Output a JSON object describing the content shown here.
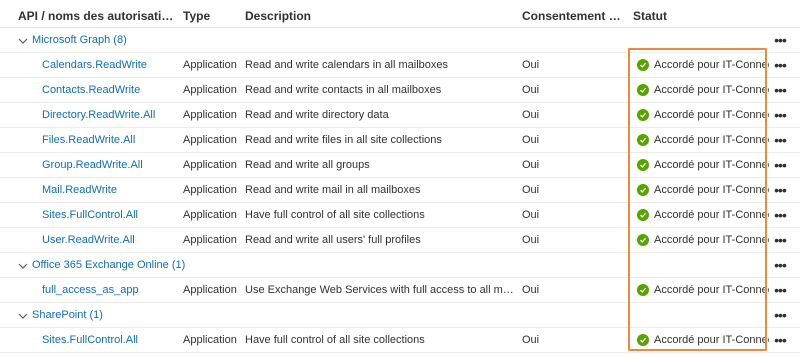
{
  "columns": {
    "name": "API / noms des autorisations",
    "type": "Type",
    "description": "Description",
    "consent": "Consentement de l'...",
    "status": "Statut"
  },
  "more_label": "•••",
  "groups": [
    {
      "label": "Microsoft Graph (8)",
      "permissions": [
        {
          "name": "Calendars.ReadWrite",
          "type": "Application",
          "description": "Read and write calendars in all mailboxes",
          "consent": "Oui",
          "status": "Accordé pour IT-Connect"
        },
        {
          "name": "Contacts.ReadWrite",
          "type": "Application",
          "description": "Read and write contacts in all mailboxes",
          "consent": "Oui",
          "status": "Accordé pour IT-Connect"
        },
        {
          "name": "Directory.ReadWrite.All",
          "type": "Application",
          "description": "Read and write directory data",
          "consent": "Oui",
          "status": "Accordé pour IT-Connect"
        },
        {
          "name": "Files.ReadWrite.All",
          "type": "Application",
          "description": "Read and write files in all site collections",
          "consent": "Oui",
          "status": "Accordé pour IT-Connect"
        },
        {
          "name": "Group.ReadWrite.All",
          "type": "Application",
          "description": "Read and write all groups",
          "consent": "Oui",
          "status": "Accordé pour IT-Connect"
        },
        {
          "name": "Mail.ReadWrite",
          "type": "Application",
          "description": "Read and write mail in all mailboxes",
          "consent": "Oui",
          "status": "Accordé pour IT-Connect"
        },
        {
          "name": "Sites.FullControl.All",
          "type": "Application",
          "description": "Have full control of all site collections",
          "consent": "Oui",
          "status": "Accordé pour IT-Connect"
        },
        {
          "name": "User.ReadWrite.All",
          "type": "Application",
          "description": "Read and write all users' full profiles",
          "consent": "Oui",
          "status": "Accordé pour IT-Connect"
        }
      ]
    },
    {
      "label": "Office 365 Exchange Online (1)",
      "permissions": [
        {
          "name": "full_access_as_app",
          "type": "Application",
          "description": "Use Exchange Web Services with full access to all mailbox...",
          "consent": "Oui",
          "status": "Accordé pour IT-Connect"
        }
      ]
    },
    {
      "label": "SharePoint (1)",
      "permissions": [
        {
          "name": "Sites.FullControl.All",
          "type": "Application",
          "description": "Have full control of all site collections",
          "consent": "Oui",
          "status": "Accordé pour IT-Connect"
        }
      ]
    }
  ],
  "colors": {
    "link": "#0f6cbd",
    "granted_check": "#57a300",
    "highlight_border": "#f0883e"
  },
  "icons": {
    "group_toggle": "chevron-down-icon",
    "status": "check-circle-icon",
    "row_actions": "more-icon"
  }
}
